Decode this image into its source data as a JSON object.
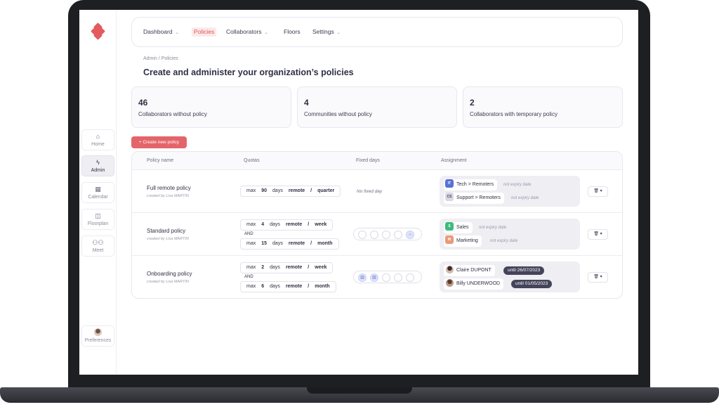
{
  "nav": {
    "home": "Home",
    "admin": "Admin",
    "calendar": "Calendar",
    "floorplan": "Floorplan",
    "meet": "Meet",
    "preferences": "Preferences"
  },
  "topnav": {
    "dashboard": "Dashboard",
    "policies": "Policies",
    "collaborators": "Collaborators",
    "floors": "Floors",
    "settings": "Settings"
  },
  "breadcrumb": "Admin / Policies",
  "title": "Create and administer your organization’s policies",
  "stats": [
    {
      "num": "46",
      "label": "Collaborators without policy"
    },
    {
      "num": "4",
      "label": "Communities without policy"
    },
    {
      "num": "2",
      "label": "Collaborators with temporary policy"
    }
  ],
  "create_label": "Create new policy",
  "table": {
    "headers": [
      "Policy name",
      "Quotas",
      "Fixed days",
      "Assignment"
    ],
    "rows": [
      {
        "name": "Full remote policy",
        "author": "created by Lisa MARTIN",
        "quotas": [
          {
            "max": "max",
            "n": "90",
            "unit": "days",
            "mode": "remote",
            "sep": "/",
            "per": "quarter"
          }
        ],
        "fixed": "No fixed day",
        "assign": [
          {
            "tag": "IT",
            "label": "Tech > Remoters",
            "expiry": "not expiry date"
          },
          {
            "tag": "CS",
            "label": "Support > Remoters",
            "expiry": "not expiry date"
          }
        ]
      },
      {
        "name": "Standard policy",
        "author": "created by Lisa MARTIN",
        "quotas": [
          {
            "max": "max",
            "n": "4",
            "unit": "days",
            "mode": "remote",
            "sep": "/",
            "per": "week"
          },
          {
            "max": "max",
            "n": "15",
            "unit": "days",
            "mode": "remote",
            "sep": "/",
            "per": "month"
          }
        ],
        "and": "AND",
        "assign": [
          {
            "tag": "S",
            "label": "Sales",
            "expiry": "not expiry date"
          },
          {
            "tag": "M",
            "label": "Marketing",
            "expiry": "not expiry date"
          }
        ]
      },
      {
        "name": "Onboarding policy",
        "author": "created by Lisa MARTIN",
        "quotas": [
          {
            "max": "max",
            "n": "2",
            "unit": "days",
            "mode": "remote",
            "sep": "/",
            "per": "week"
          },
          {
            "max": "max",
            "n": "6",
            "unit": "days",
            "mode": "remote",
            "sep": "/",
            "per": "month"
          }
        ],
        "and": "AND",
        "assign": [
          {
            "label": "Claire DUPONT",
            "until": "until 26/07/2023"
          },
          {
            "label": "Billy UNDERWOOD",
            "until": "until 01/05/2023"
          }
        ]
      }
    ]
  },
  "colors": {
    "accent": "#e3545a",
    "tag_it": "#5b6fd6",
    "tag_cs": "#c9cad6",
    "tag_sales": "#3dbb7c",
    "tag_marketing": "#e89a7a"
  }
}
